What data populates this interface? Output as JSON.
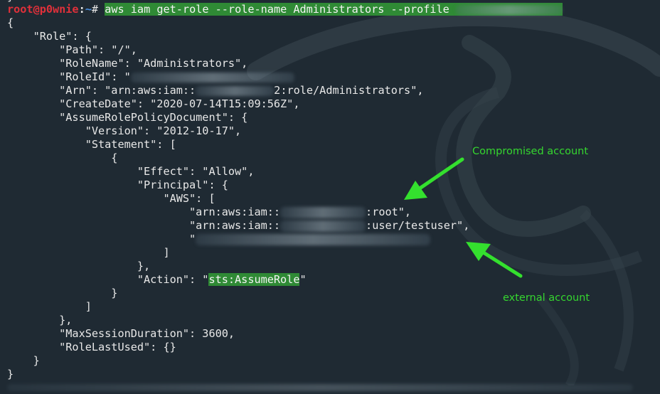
{
  "colors": {
    "background": "#1f2a33",
    "prompt_user": "#e0303a",
    "prompt_path": "#4a8fe0",
    "highlight": "#2f8a35",
    "annotation": "#35d62f",
    "arrow": "#34e02e"
  },
  "prompt": {
    "user_host": "root@p0wnie",
    "separator": ":",
    "path": "~",
    "symbol": "# ",
    "command": "aws iam get-role --role-name Administrators --profile "
  },
  "output": {
    "l01": "{",
    "l02": "    \"Role\": {",
    "l03": "        \"Path\": \"/\",",
    "l04": "        \"RoleName\": \"Administrators\",",
    "l05_key": "        \"RoleId\": \"",
    "l06_a": "        \"Arn\": \"arn:aws:iam::",
    "l06_b": "2:role/Administrators\",",
    "l07": "        \"CreateDate\": \"2020-07-14T15:09:56Z\",",
    "l08": "        \"AssumeRolePolicyDocument\": {",
    "l09": "            \"Version\": \"2012-10-17\",",
    "l10": "            \"Statement\": [",
    "l11": "                {",
    "l12": "                    \"Effect\": \"Allow\",",
    "l13": "                    \"Principal\": {",
    "l14": "                        \"AWS\": [",
    "l15_a": "                            \"arn:aws:iam::",
    "l15_b": ":root\",",
    "l16_a": "                            \"arn:aws:iam::",
    "l16_b": ":user/testuser\",",
    "l17": "                            \"",
    "l18": "                        ]",
    "l19": "                    },",
    "l20_a": "                    \"Action\": \"",
    "l20_hl": "sts:AssumeRole",
    "l20_b": "\"",
    "l21": "                }",
    "l22": "            ]",
    "l23": "        },",
    "l24": "        \"MaxSessionDuration\": 3600,",
    "l25": "        \"RoleLastUsed\": {}",
    "l26": "    }",
    "l27": "}"
  },
  "annotations": {
    "compromised": "Compromised account",
    "external": "external account"
  },
  "icons": [
    "kali-dragon-watermark",
    "arrow-icon"
  ]
}
